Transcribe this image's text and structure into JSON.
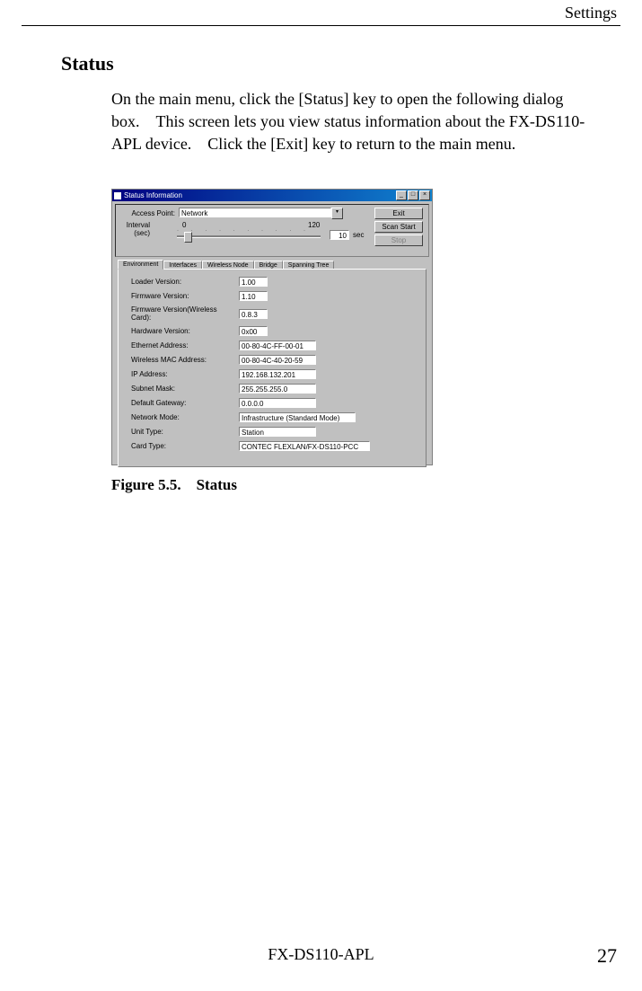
{
  "header": {
    "right_label": "Settings"
  },
  "section": {
    "title": "Status"
  },
  "body": {
    "paragraph": "On the main menu, click the [Status] key to open the following dialog box. This screen lets you view status information about the FX-DS110-APL device. Click the [Exit] key to return to the main menu."
  },
  "dialog": {
    "title": "Status Information",
    "access_point_label": "Access Point:",
    "access_point_value": "Network",
    "interval_label_1": "Interval",
    "interval_label_2": "(sec)",
    "slider_min": "0",
    "slider_max": "120",
    "interval_value": "10",
    "sec_label": "sec",
    "exit_btn": "Exit",
    "scan_start_btn": "Scan Start",
    "stop_btn": "Stop",
    "tabs": [
      "Environment",
      "Interfaces",
      "Wireless Node",
      "Bridge",
      "Spanning Tree"
    ],
    "fields": [
      {
        "label": "Loader Version:",
        "value": "1.00"
      },
      {
        "label": "Firmware Version:",
        "value": "1.10"
      },
      {
        "label": "Firmware Version(Wireless Card):",
        "value": "0.8.3"
      },
      {
        "label": "Hardware Version:",
        "value": "0x00"
      },
      {
        "label": "Ethernet Address:",
        "value": "00-80-4C-FF-00-01"
      },
      {
        "label": "Wireless MAC Address:",
        "value": "00-80-4C-40-20-59"
      },
      {
        "label": "IP Address:",
        "value": "192.168.132.201"
      },
      {
        "label": "Subnet Mask:",
        "value": "255.255.255.0"
      },
      {
        "label": "Default Gateway:",
        "value": "0.0.0.0"
      },
      {
        "label": "Network Mode:",
        "value": "Infrastructure (Standard Mode)"
      },
      {
        "label": "Unit Type:",
        "value": "Station"
      },
      {
        "label": "Card Type:",
        "value": "CONTEC FLEXLAN/FX-DS110-PCC"
      }
    ]
  },
  "caption": {
    "text": "Figure 5.5. Status"
  },
  "footer": {
    "center": "FX-DS110-APL",
    "page": "27"
  }
}
